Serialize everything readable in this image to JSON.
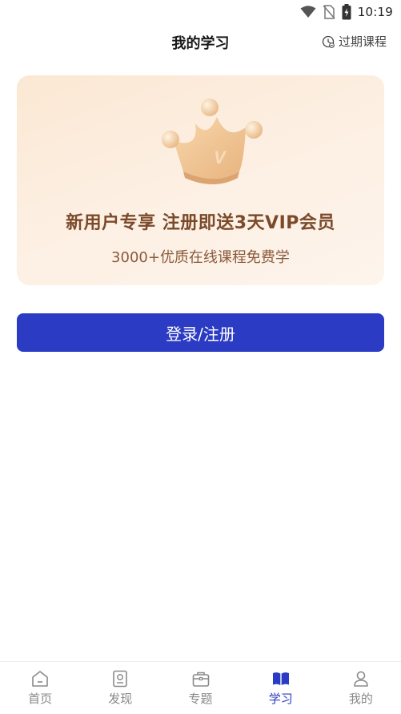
{
  "status_bar": {
    "time": "10:19"
  },
  "header": {
    "title": "我的学习",
    "expired_label": "过期课程"
  },
  "promo": {
    "title": "新用户专享 注册即送3天VIP会员",
    "subtitle": "3000+优质在线课程免费学"
  },
  "login_button": {
    "label": "登录/注册"
  },
  "tabbar": {
    "items": [
      {
        "label": "首页",
        "icon": "home-icon",
        "active": false
      },
      {
        "label": "发现",
        "icon": "discover-icon",
        "active": false
      },
      {
        "label": "专题",
        "icon": "topic-icon",
        "active": false
      },
      {
        "label": "学习",
        "icon": "study-icon",
        "active": true
      },
      {
        "label": "我的",
        "icon": "profile-icon",
        "active": false
      }
    ]
  },
  "colors": {
    "accent": "#2b3bc3",
    "promo_text": "#7b4a2a",
    "inactive": "#888888"
  }
}
